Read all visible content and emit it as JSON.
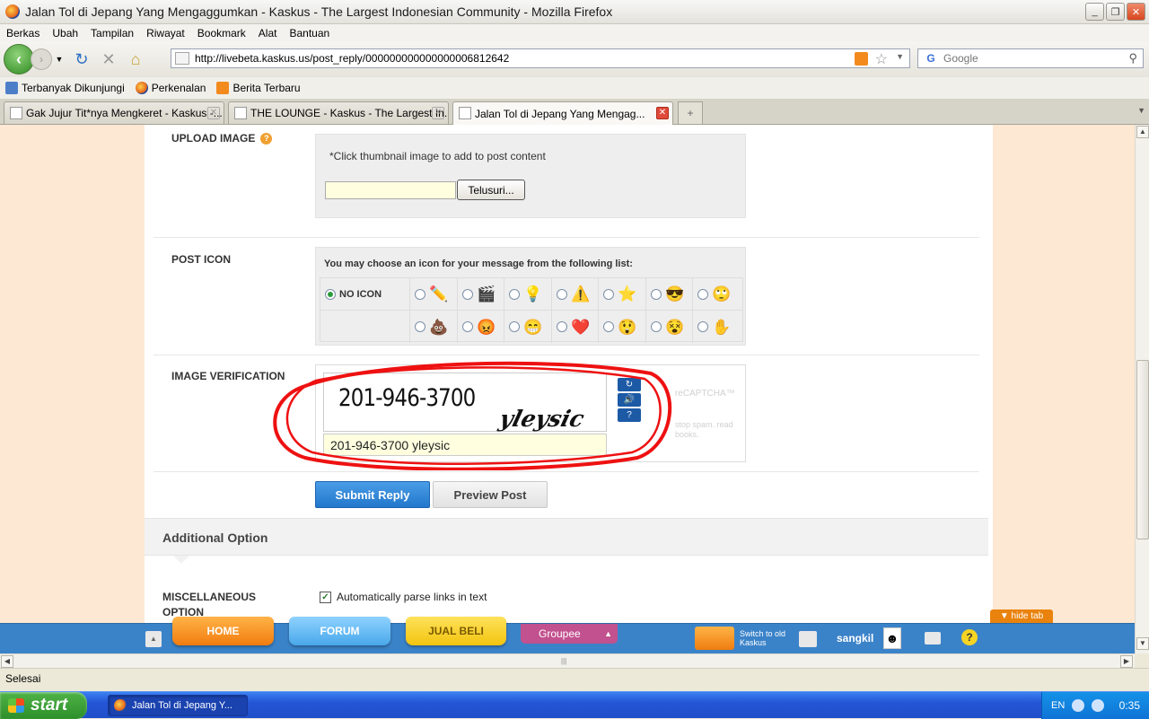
{
  "window": {
    "title": "Jalan Tol di Jepang Yang Mengaggumkan - Kaskus - The Largest Indonesian Community - Mozilla Firefox"
  },
  "menu": [
    "Berkas",
    "Ubah",
    "Tampilan",
    "Riwayat",
    "Bookmark",
    "Alat",
    "Bantuan"
  ],
  "address": {
    "url": "http://livebeta.kaskus.us/post_reply/000000000000000006812642",
    "search_placeholder": "Google"
  },
  "bookmarks": [
    "Terbanyak Dikunjungi",
    "Perkenalan",
    "Berita Terbaru"
  ],
  "tabs": [
    {
      "label": "Gak Jujur Tit*nya Mengkeret - Kaskus -..."
    },
    {
      "label": "THE LOUNGE - Kaskus - The Largest In..."
    },
    {
      "label": "Jalan Tol di Jepang Yang Mengag..."
    }
  ],
  "form": {
    "upload": {
      "label": "UPLOAD IMAGE",
      "help": "?",
      "note": "*Click thumbnail image to add to post content",
      "browse_label": "Telusuri..."
    },
    "post_icon": {
      "label": "POST ICON",
      "header": "You may choose an icon for your message from the following list:",
      "no_icon": "NO ICON",
      "icons_row1": [
        "✏️",
        "🎬",
        "💡",
        "⚠️",
        "⭐",
        "😎",
        "🙄"
      ],
      "icons_row2": [
        "💩",
        "😡",
        "😁",
        "❤️",
        "😲",
        "😵",
        "✋"
      ]
    },
    "verification": {
      "label": "IMAGE VERIFICATION",
      "captcha_word1": "201-946-3700",
      "captcha_word2": "yleysic",
      "input_value": "201-946-3700 yleysic",
      "recaptcha_brand": "reCAPTCHA™",
      "recaptcha_tagline": "stop spam. read books."
    },
    "submit_label": "Submit Reply",
    "preview_label": "Preview Post",
    "additional_option": "Additional Option",
    "misc": {
      "label": "MISCELLANEOUS OPTION",
      "auto_parse": "Automatically parse links in text"
    }
  },
  "kaskus_bar": {
    "home": "HOME",
    "forum": "FORUM",
    "jual_beli": "JUAL BELI",
    "groupee": "Groupee",
    "switch": "Switch to old Kaskus",
    "username": "sangkil",
    "hide_tab": "hide tab"
  },
  "status": "Selesai",
  "taskbar": {
    "start": "start",
    "task": "Jalan Tol di Jepang Y...",
    "lang": "EN",
    "clock": "0:35"
  }
}
